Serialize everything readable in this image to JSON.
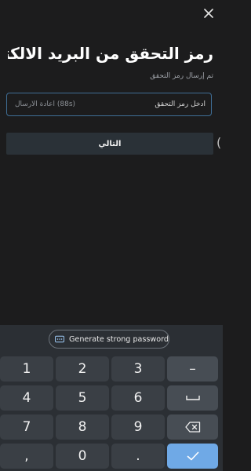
{
  "screen": {
    "title": "رمز التحقق من البريد الالكتروني",
    "subtitle": "تم إرسال رمز التحقق",
    "code_field": {
      "placeholder": "ادخل رمز التحقق",
      "value": "",
      "resend_label": "اعادة الارسال",
      "resend_timer": "(88s)"
    },
    "next_button": "التالي",
    "edge_glyph": "("
  },
  "keyboard": {
    "suggestion": "Generate strong password",
    "keys": {
      "k1": "1",
      "k2": "2",
      "k3": "3",
      "minus": "–",
      "k4": "4",
      "k5": "5",
      "k6": "6",
      "k7": "7",
      "k8": "8",
      "k9": "9",
      "comma": ",",
      "k0": "0",
      "period": "."
    },
    "icons": {
      "close": "close-icon",
      "key": "key-icon",
      "space": "space-bar-icon",
      "backspace": "backspace-icon",
      "enter": "checkmark-icon"
    },
    "colors": {
      "background": "#1c1c1d",
      "field_border": "#3f6e96",
      "next_button": "#2a3137",
      "keyboard_bg": "#2b2f34",
      "key_bg": "#3a3f45",
      "fn_key_bg": "#474d54",
      "enter_key_bg": "#6fa9e6"
    }
  }
}
